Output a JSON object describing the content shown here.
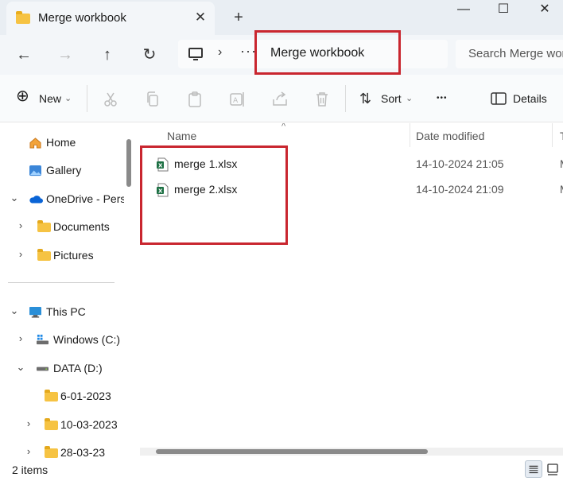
{
  "window": {
    "tab_title": "Merge workbook",
    "close_tab_glyph": "✕",
    "new_tab_glyph": "+",
    "minimize_glyph": "—",
    "maximize_glyph": "☐",
    "close_glyph": "✕"
  },
  "address": {
    "back_glyph": "←",
    "forward_glyph": "→",
    "up_glyph": "↑",
    "refresh_glyph": "↻",
    "separator": "›",
    "overflow": "···",
    "current_folder": "Merge workbook",
    "search_placeholder": "Search Merge workbook"
  },
  "commands": {
    "new_label": "New",
    "new_glyph": "⊕",
    "dropdown_glyph": "⌄",
    "sort_label": "Sort",
    "sort_glyph": "⇅",
    "more_glyph": "•••",
    "details_label": "Details"
  },
  "navigation": {
    "quick": [
      {
        "label": "Home"
      },
      {
        "label": "Gallery"
      }
    ],
    "onedrive": {
      "label": "OneDrive - Personal",
      "chevron": "⌄"
    },
    "onedrive_children": [
      {
        "label": "Documents",
        "chevron": "›"
      },
      {
        "label": "Pictures",
        "chevron": "›"
      }
    ],
    "this_pc": {
      "label": "This PC",
      "chevron": "⌄"
    },
    "drives": [
      {
        "label": "Windows (C:)",
        "chevron": "›"
      },
      {
        "label": "DATA (D:)",
        "chevron": "⌄"
      }
    ],
    "data_folders": [
      {
        "label": "6-01-2023",
        "chevron": ""
      },
      {
        "label": "10-03-2023",
        "chevron": "›"
      },
      {
        "label": "28-03-23",
        "chevron": "›"
      }
    ]
  },
  "columns": {
    "name": "Name",
    "date_modified": "Date modified",
    "type": "Type",
    "sort_caret": "^"
  },
  "files": [
    {
      "name": "merge 1.xlsx",
      "date": "14-10-2024 21:05",
      "type": "Microsoft Excel Worksheet"
    },
    {
      "name": "merge 2.xlsx",
      "date": "14-10-2024 21:09",
      "type": "Microsoft Excel Worksheet"
    }
  ],
  "status": {
    "items_count": "2 items"
  },
  "colors": {
    "highlight_red": "#c9262f",
    "folder_yellow": "#f6c343",
    "excel_green": "#1d7044",
    "onedrive_blue": "#0a64d6"
  }
}
